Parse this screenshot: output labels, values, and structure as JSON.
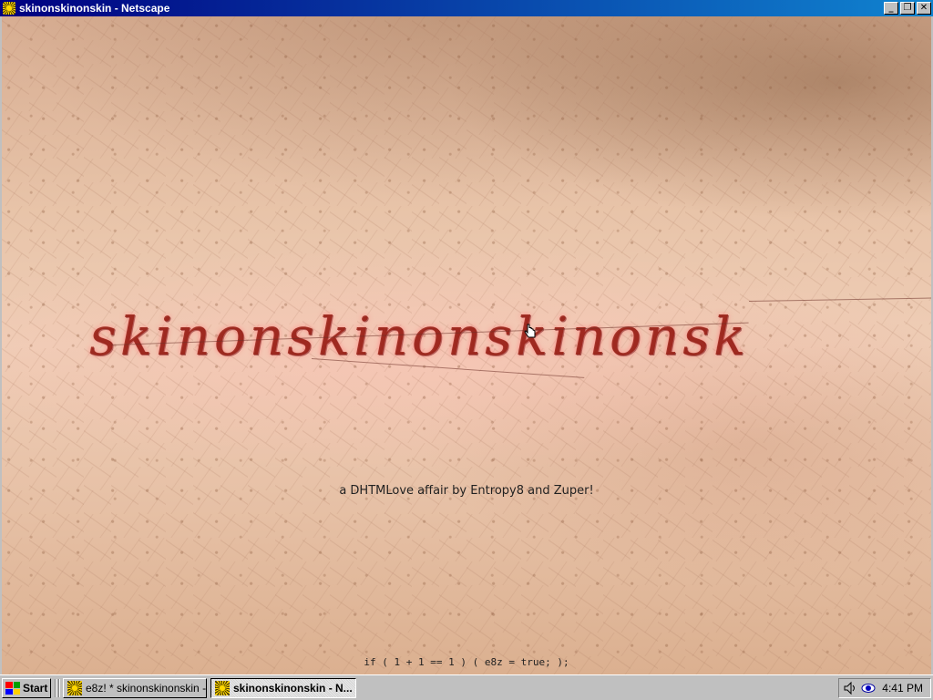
{
  "window": {
    "title": "skinonskinonskin - Netscape",
    "controls": [
      "minimize",
      "maximize",
      "close"
    ]
  },
  "page": {
    "carved_text": "skinonskinonskinonsk",
    "credit": "a DHTMLove affair by Entropy8 and Zuper!",
    "code_line": "if ( 1 + 1 == 1 ) ( e8z = true; );"
  },
  "taskbar": {
    "start_label": "Start",
    "tasks": [
      {
        "label": "e8z! * skinonskinonskin - ...",
        "active": false
      },
      {
        "label": "skinonskinonskin - N...",
        "active": true
      }
    ],
    "tray": {
      "icons": [
        "speaker-icon",
        "eye-icon"
      ],
      "time": "4:41 PM"
    }
  }
}
